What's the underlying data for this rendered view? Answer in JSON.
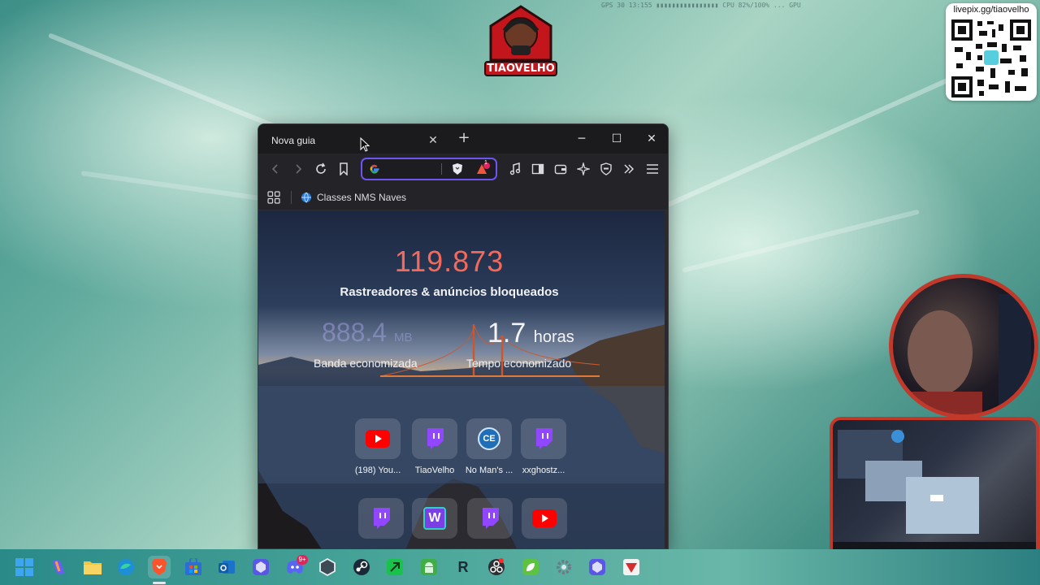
{
  "overlay": {
    "logo_text": "TIAOVELHO",
    "stats_text": "GPS 30  13:155  ▮▮▮▮▮▮▮▮▮▮▮▮▮▮▮▮  CPU 82%/100%  ...  GPU",
    "qr_url": "livepix.gg/tiaovelho"
  },
  "browser": {
    "tab_title": "Nova guia",
    "new_tab_icon": "plus-icon",
    "address_value": "",
    "bookmarks": [
      {
        "label": "Classes NMS Naves",
        "icon": "globe-icon"
      }
    ],
    "accent_color": "#6c55f0",
    "shields_badge": "1"
  },
  "newtab": {
    "trackers_count": "119.873",
    "trackers_label": "Rastreadores & anúncios bloqueados",
    "bandwidth_value": "888.4",
    "bandwidth_unit": "MB",
    "bandwidth_label": "Banda economizada",
    "time_value": "1.7",
    "time_unit": "horas",
    "time_label": "Tempo economizado",
    "tiles_row1": [
      {
        "label": "(198) You...",
        "icon": "youtube-icon"
      },
      {
        "label": "TiaoVelho",
        "icon": "twitch-icon"
      },
      {
        "label": "No Man's ...",
        "icon": "ce-icon",
        "icon_text": "CE"
      },
      {
        "label": "xxghostz...",
        "icon": "twitch-icon"
      }
    ],
    "tiles_row2": [
      {
        "label": "",
        "icon": "twitch-icon"
      },
      {
        "label": "",
        "icon": "w-icon",
        "icon_text": "W"
      },
      {
        "label": "",
        "icon": "twitch-icon"
      },
      {
        "label": "",
        "icon": "youtube-icon"
      }
    ]
  },
  "taskbar": {
    "discord_badge": "9+",
    "apps": [
      "start",
      "copilot",
      "file-explorer",
      "edge",
      "brave",
      "store",
      "outlook",
      "app-purple",
      "discord",
      "app-hex",
      "steam",
      "app-green",
      "android",
      "r-app",
      "obs",
      "app-greenleaf",
      "settings",
      "app-purple-2",
      "app-red"
    ]
  }
}
